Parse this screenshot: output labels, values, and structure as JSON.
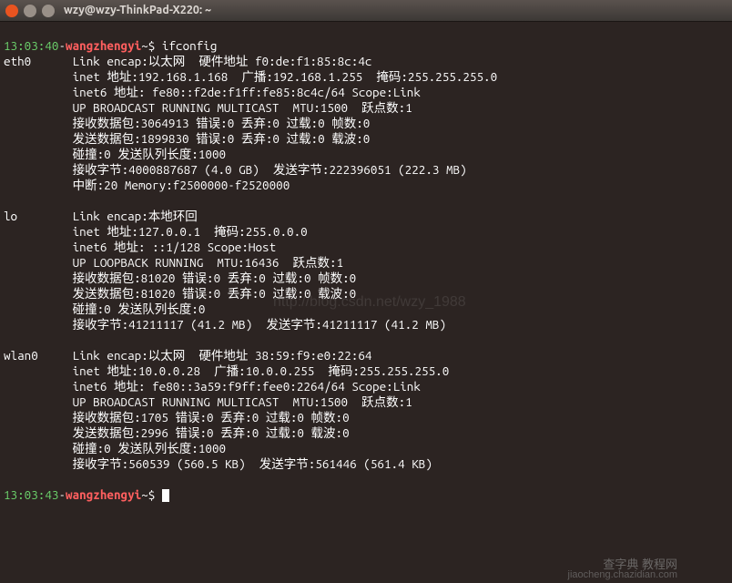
{
  "window": {
    "title": "wzy@wzy-ThinkPad-X220: ~"
  },
  "prompt1": {
    "time": "13:03:40",
    "sep": "-",
    "host": "wangzhengyi",
    "sym": "~$ ",
    "cmd": "ifconfig"
  },
  "output": {
    "eth0": {
      "name": "eth0",
      "l1": "Link encap:以太网  硬件地址 f0:de:f1:85:8c:4c",
      "l2": "inet 地址:192.168.1.168  广播:192.168.1.255  掩码:255.255.255.0",
      "l3": "inet6 地址: fe80::f2de:f1ff:fe85:8c4c/64 Scope:Link",
      "l4": "UP BROADCAST RUNNING MULTICAST  MTU:1500  跃点数:1",
      "l5": "接收数据包:3064913 错误:0 丢弃:0 过载:0 帧数:0",
      "l6": "发送数据包:1899830 错误:0 丢弃:0 过载:0 载波:0",
      "l7": "碰撞:0 发送队列长度:1000",
      "l8": "接收字节:4000887687 (4.0 GB)  发送字节:222396051 (222.3 MB)",
      "l9": "中断:20 Memory:f2500000-f2520000"
    },
    "lo": {
      "name": "lo",
      "l1": "Link encap:本地环回",
      "l2": "inet 地址:127.0.0.1  掩码:255.0.0.0",
      "l3": "inet6 地址: ::1/128 Scope:Host",
      "l4": "UP LOOPBACK RUNNING  MTU:16436  跃点数:1",
      "l5": "接收数据包:81020 错误:0 丢弃:0 过载:0 帧数:0",
      "l6": "发送数据包:81020 错误:0 丢弃:0 过载:0 载波:0",
      "l7": "碰撞:0 发送队列长度:0",
      "l8": "接收字节:41211117 (41.2 MB)  发送字节:41211117 (41.2 MB)"
    },
    "wlan0": {
      "name": "wlan0",
      "l1": "Link encap:以太网  硬件地址 38:59:f9:e0:22:64",
      "l2": "inet 地址:10.0.0.28  广播:10.0.0.255  掩码:255.255.255.0",
      "l3": "inet6 地址: fe80::3a59:f9ff:fee0:2264/64 Scope:Link",
      "l4": "UP BROADCAST RUNNING MULTICAST  MTU:1500  跃点数:1",
      "l5": "接收数据包:1705 错误:0 丢弃:0 过载:0 帧数:0",
      "l6": "发送数据包:2996 错误:0 丢弃:0 过载:0 载波:0",
      "l7": "碰撞:0 发送队列长度:1000",
      "l8": "接收字节:560539 (560.5 KB)  发送字节:561446 (561.4 KB)"
    }
  },
  "prompt2": {
    "time": "13:03:43",
    "sep": "-",
    "host": "wangzhengyi",
    "sym": "~$ "
  },
  "watermark": {
    "center": "http://blog.csdn.net/wzy_1988",
    "brand": "查字典 教程网",
    "url": "jiaocheng.chazidian.com"
  }
}
